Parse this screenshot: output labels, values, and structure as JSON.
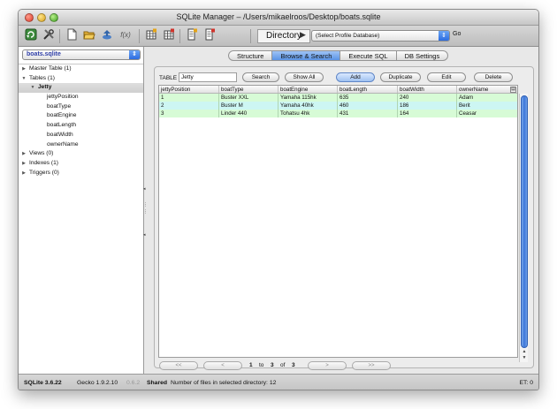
{
  "window": {
    "title": "SQLite Manager – /Users/mikaelroos/Desktop/boats.sqlite"
  },
  "toolbar": {
    "icons": [
      "reconnect-icon",
      "settings-icon",
      "new-db-icon",
      "open-db-icon",
      "attach-icon",
      "function-icon",
      "create-table-icon",
      "drop-table-icon",
      "create-index-icon",
      "drop-index-icon"
    ],
    "function_glyph": "f(x)",
    "directory_label": "Directory",
    "profile_select_value": "(Select Profile Database)",
    "go_label": "Go"
  },
  "sidebar": {
    "db_select_value": "boats.sqlite",
    "tree": [
      {
        "label": "Master Table (1)",
        "level": 0,
        "expanded": false,
        "twisty": true
      },
      {
        "label": "Tables (1)",
        "level": 0,
        "expanded": true,
        "twisty": true
      },
      {
        "label": "Jetty",
        "level": 1,
        "expanded": true,
        "twisty": true,
        "selected": true
      },
      {
        "label": "jettyPosition",
        "level": 2
      },
      {
        "label": "boatType",
        "level": 2
      },
      {
        "label": "boatEngine",
        "level": 2
      },
      {
        "label": "boatLength",
        "level": 2
      },
      {
        "label": "boatWidth",
        "level": 2
      },
      {
        "label": "ownerName",
        "level": 2
      },
      {
        "label": "Views (0)",
        "level": 0,
        "expanded": false,
        "twisty": true
      },
      {
        "label": "Indexes (1)",
        "level": 0,
        "expanded": false,
        "twisty": true
      },
      {
        "label": "Triggers (0)",
        "level": 0,
        "expanded": false,
        "twisty": true
      }
    ]
  },
  "tabs": [
    {
      "label": "Structure",
      "active": false
    },
    {
      "label": "Browse & Search",
      "active": true
    },
    {
      "label": "Execute SQL",
      "active": false
    },
    {
      "label": "DB Settings",
      "active": false
    }
  ],
  "browse": {
    "table_label": "TABLE",
    "table_value": "Jetty",
    "search_label": "Search",
    "show_all_label": "Show All",
    "add_label": "Add",
    "duplicate_label": "Duplicate",
    "edit_label": "Edit",
    "delete_label": "Delete",
    "columns": [
      "jettyPosition",
      "boatType",
      "boatEngine",
      "boatLength",
      "boatWidth",
      "ownerName"
    ],
    "rows": [
      [
        "1",
        "Buster XXL",
        "Yamaha 115hk",
        "635",
        "240",
        "Adam"
      ],
      [
        "2",
        "Buster M",
        "Yamaha 40hk",
        "460",
        "186",
        "Berit"
      ],
      [
        "3",
        "Linder 440",
        "Tohatsu 4hk",
        "431",
        "164",
        "Ceasar"
      ]
    ],
    "nav": {
      "first": "<<",
      "prev": "<",
      "from": "1",
      "to_word": "to",
      "to": "3",
      "of_word": "of",
      "total": "3",
      "next": ">",
      "last": ">>"
    }
  },
  "status": {
    "sqlite_version": "SQLite 3.6.22",
    "gecko_version": "Gecko 1.9.2.10",
    "ext_version": "0.6.2",
    "mode": "Shared",
    "message": "Number of files in selected directory: 12",
    "elapsed": "ET: 0"
  }
}
